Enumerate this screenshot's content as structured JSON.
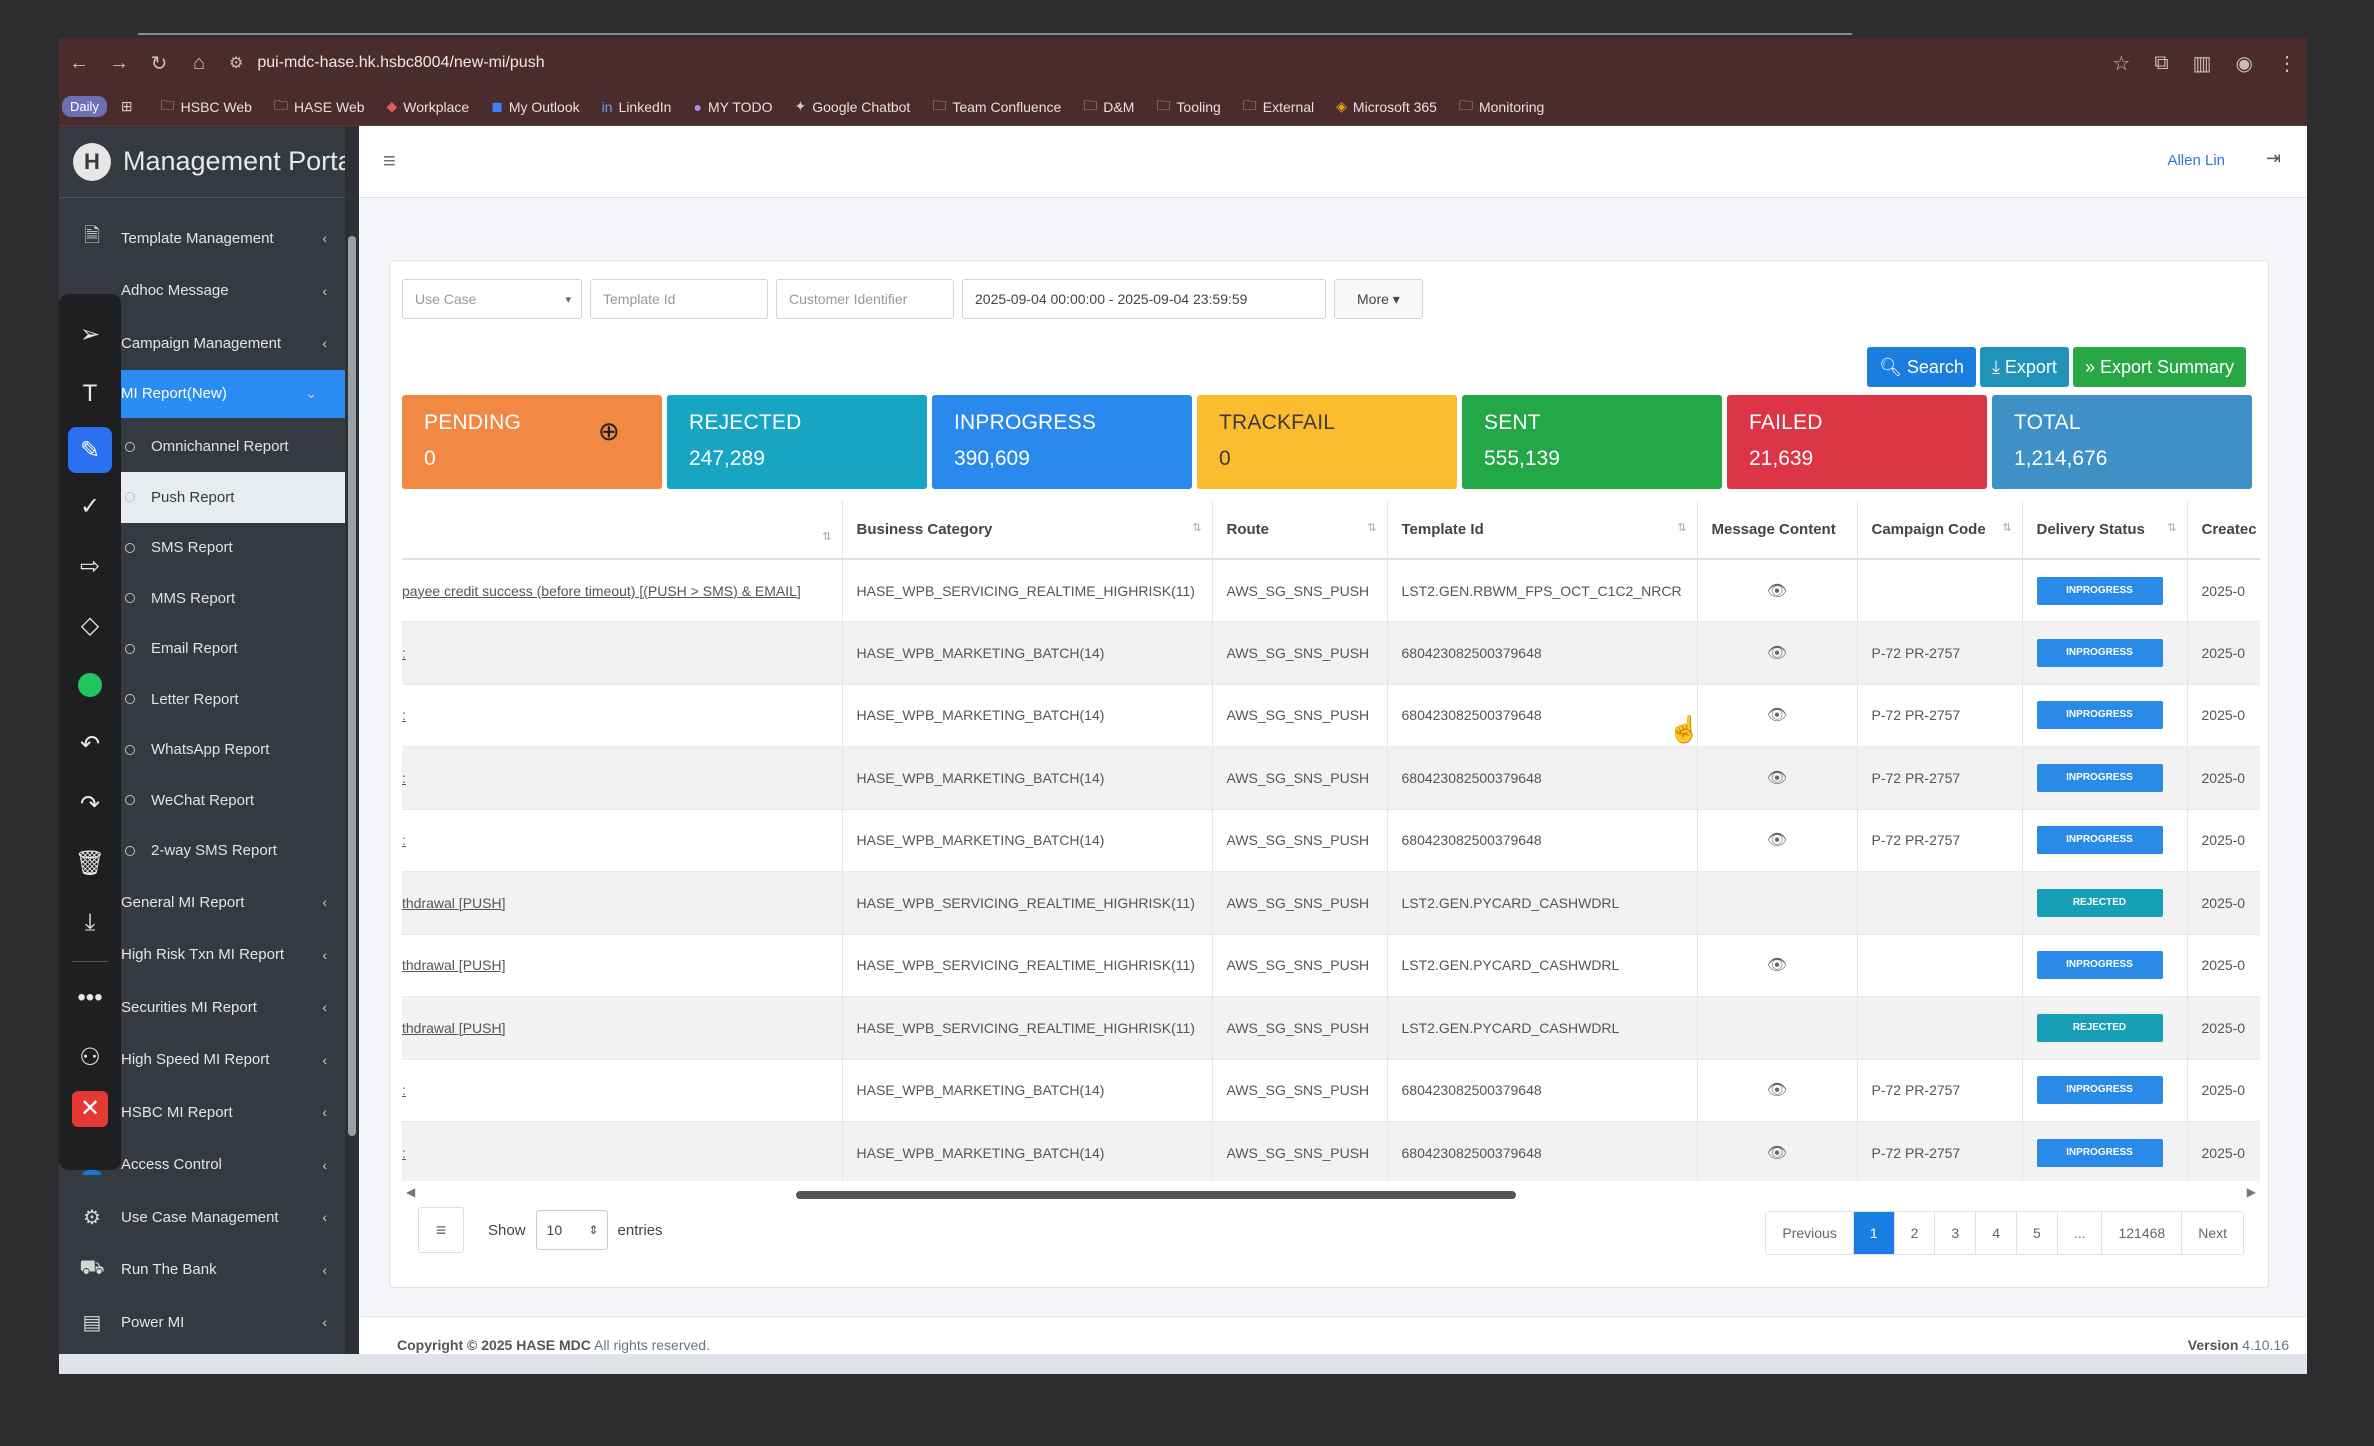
{
  "browser": {
    "url": "pui-mdc-hase.hk.hsbc8004/new-mi/push",
    "bookmarks": [
      "Daily",
      "HSBC Web",
      "HASE Web",
      "Workplace",
      "My Outlook",
      "LinkedIn",
      "MY TODO",
      "Google Chatbot",
      "Team Confluence",
      "D&M",
      "Tooling",
      "External",
      "Microsoft 365",
      "Monitoring"
    ]
  },
  "sidebar": {
    "brand": "Management Portal",
    "items": [
      {
        "label": "Template Management"
      },
      {
        "label": "Adhoc Message"
      },
      {
        "label": "Campaign Management"
      },
      {
        "label": "MI Report(New)"
      },
      {
        "label": "Omnichannel Report"
      },
      {
        "label": "Push Report"
      },
      {
        "label": "SMS Report"
      },
      {
        "label": "MMS Report"
      },
      {
        "label": "Email Report"
      },
      {
        "label": "Letter Report"
      },
      {
        "label": "WhatsApp Report"
      },
      {
        "label": "WeChat Report"
      },
      {
        "label": "2-way SMS Report"
      },
      {
        "label": "General MI Report"
      },
      {
        "label": "High Risk Txn MI Report"
      },
      {
        "label": "Securities MI Report"
      },
      {
        "label": "High Speed MI Report"
      },
      {
        "label": "HSBC MI Report"
      },
      {
        "label": "Access Control"
      },
      {
        "label": "Use Case Management"
      },
      {
        "label": "Run The Bank"
      },
      {
        "label": "Power MI"
      }
    ]
  },
  "header": {
    "user": "Allen Lin"
  },
  "filters": {
    "use_case": "Use Case",
    "template_id": "Template Id",
    "customer_identifier": "Customer Identifier",
    "date_range": "2025-09-04 00:00:00 - 2025-09-04 23:59:59",
    "more": "More"
  },
  "actions": {
    "search": "Search",
    "export": "Export",
    "export_summary": "Export Summary"
  },
  "stats": [
    {
      "label": "PENDING",
      "value": "0"
    },
    {
      "label": "REJECTED",
      "value": "247,289"
    },
    {
      "label": "INPROGRESS",
      "value": "390,609"
    },
    {
      "label": "TRACKFAIL",
      "value": "0"
    },
    {
      "label": "SENT",
      "value": "555,139"
    },
    {
      "label": "FAILED",
      "value": "21,639"
    },
    {
      "label": "TOTAL",
      "value": "1,214,676"
    }
  ],
  "table": {
    "headers": [
      "",
      "Business Category",
      "Route",
      "Template Id",
      "Message Content",
      "Campaign Code",
      "Delivery Status",
      "Createc"
    ],
    "rows": [
      {
        "c0": "payee credit success (before timeout) [(PUSH > SMS) & EMAIL]",
        "cat": "HASE_WPB_SERVICING_REALTIME_HIGHRISK(11)",
        "route": "AWS_SG_SNS_PUSH",
        "tid": "LST2.GEN.RBWM_FPS_OCT_C1C2_NRCR",
        "msg": true,
        "camp": "",
        "status": "INPROGRESS",
        "created": "2025-0"
      },
      {
        "c0": ":",
        "cat": "HASE_WPB_MARKETING_BATCH(14)",
        "route": "AWS_SG_SNS_PUSH",
        "tid": "680423082500379648",
        "msg": true,
        "camp": "P-72 PR-2757",
        "status": "INPROGRESS",
        "created": "2025-0"
      },
      {
        "c0": ":",
        "cat": "HASE_WPB_MARKETING_BATCH(14)",
        "route": "AWS_SG_SNS_PUSH",
        "tid": "680423082500379648",
        "msg": true,
        "camp": "P-72 PR-2757",
        "status": "INPROGRESS",
        "created": "2025-0"
      },
      {
        "c0": ":",
        "cat": "HASE_WPB_MARKETING_BATCH(14)",
        "route": "AWS_SG_SNS_PUSH",
        "tid": "680423082500379648",
        "msg": true,
        "camp": "P-72 PR-2757",
        "status": "INPROGRESS",
        "created": "2025-0"
      },
      {
        "c0": ":",
        "cat": "HASE_WPB_MARKETING_BATCH(14)",
        "route": "AWS_SG_SNS_PUSH",
        "tid": "680423082500379648",
        "msg": true,
        "camp": "P-72 PR-2757",
        "status": "INPROGRESS",
        "created": "2025-0"
      },
      {
        "c0": "thdrawal [PUSH]",
        "cat": "HASE_WPB_SERVICING_REALTIME_HIGHRISK(11)",
        "route": "AWS_SG_SNS_PUSH",
        "tid": "LST2.GEN.PYCARD_CASHWDRL",
        "msg": false,
        "camp": "",
        "status": "REJECTED",
        "created": "2025-0"
      },
      {
        "c0": "thdrawal [PUSH]",
        "cat": "HASE_WPB_SERVICING_REALTIME_HIGHRISK(11)",
        "route": "AWS_SG_SNS_PUSH",
        "tid": "LST2.GEN.PYCARD_CASHWDRL",
        "msg": true,
        "camp": "",
        "status": "INPROGRESS",
        "created": "2025-0"
      },
      {
        "c0": "thdrawal [PUSH]",
        "cat": "HASE_WPB_SERVICING_REALTIME_HIGHRISK(11)",
        "route": "AWS_SG_SNS_PUSH",
        "tid": "LST2.GEN.PYCARD_CASHWDRL",
        "msg": false,
        "camp": "",
        "status": "REJECTED",
        "created": "2025-0"
      },
      {
        "c0": ":",
        "cat": "HASE_WPB_MARKETING_BATCH(14)",
        "route": "AWS_SG_SNS_PUSH",
        "tid": "680423082500379648",
        "msg": true,
        "camp": "P-72 PR-2757",
        "status": "INPROGRESS",
        "created": "2025-0"
      },
      {
        "c0": ":",
        "cat": "HASE_WPB_MARKETING_BATCH(14)",
        "route": "AWS_SG_SNS_PUSH",
        "tid": "680423082500379648",
        "msg": true,
        "camp": "P-72 PR-2757",
        "status": "INPROGRESS",
        "created": "2025-0"
      }
    ]
  },
  "table_footer": {
    "show": "Show",
    "page_length": "10",
    "entries": "entries"
  },
  "pagination": [
    "Previous",
    "1",
    "2",
    "3",
    "4",
    "5",
    "...",
    "121468",
    "Next"
  ],
  "footer": {
    "copyright_prefix": "Copyright © 2025",
    "copyright_org": "HASE MDC",
    "copyright_suffix": "All rights reserved.",
    "version_label": "Version",
    "version": "4.10.16"
  }
}
